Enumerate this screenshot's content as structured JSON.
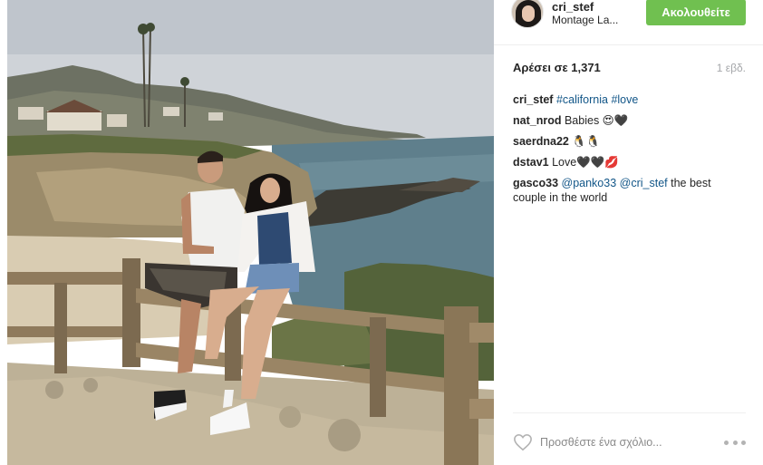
{
  "post": {
    "photo_alt": "Couple sitting on a wooden fence overlooking the California coast"
  },
  "header": {
    "username": "cri_stef",
    "location": "Montage La...",
    "follow_label": "Ακολουθείτε"
  },
  "stats": {
    "likes": "Αρέσει σε 1,371",
    "time": "1 εβδ."
  },
  "comments": [
    {
      "user": "cri_stef",
      "parts": [
        "#california",
        "#love"
      ]
    },
    {
      "user": "nat_nrod",
      "text": "Babies 😍🖤"
    },
    {
      "user": "saerdna22",
      "text": "🐧🐧"
    },
    {
      "user": "dstav1",
      "text": "Love🖤🖤💋"
    },
    {
      "user": "gasco33",
      "mention1": "@panko33",
      "mention2": "@cri_stef",
      "text": "the best couple in the world"
    }
  ],
  "footer": {
    "comment_placeholder": "Προσθέστε ένα σχόλιο..."
  },
  "colors": {
    "follow_green": "#70c050",
    "link_blue": "#125688",
    "timestamp_grey": "#a5a7aa"
  },
  "icons": {
    "like": "heart-outline-icon",
    "more": "more-options-icon"
  }
}
